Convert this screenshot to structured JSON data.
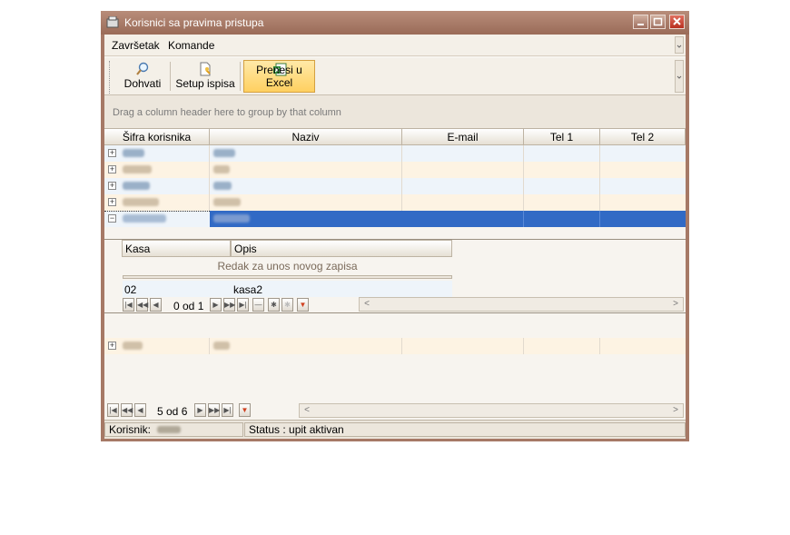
{
  "window": {
    "title": "Korisnici sa pravima pristupa"
  },
  "menu": {
    "items": [
      "Završetak",
      "Komande"
    ]
  },
  "toolbar": {
    "fetch": "Dohvati",
    "print_setup": "Setup ispisa",
    "export_excel": "Prenesi u Excel"
  },
  "grid": {
    "group_hint": "Drag a column header here to group by that column",
    "columns": [
      "Šifra korisnika",
      "Naziv",
      "E-mail",
      "Tel 1",
      "Tel 2"
    ],
    "nav_text": "5 od 6"
  },
  "detail": {
    "columns": [
      "Kasa",
      "Opis"
    ],
    "new_row_text": "Redak za unos novog zapisa",
    "rows": [
      {
        "kasa": "02",
        "opis": "kasa2"
      }
    ],
    "nav_text": "0 od 1"
  },
  "status": {
    "user_label": "Korisnik:",
    "status_text": "Status : upit aktivan"
  },
  "colors": {
    "titlebar": "#a67966",
    "selected_row": "#316ac5",
    "alt_row": "#fdf3e3",
    "row": "#eef4fa",
    "active_tool": "#ffd060"
  }
}
